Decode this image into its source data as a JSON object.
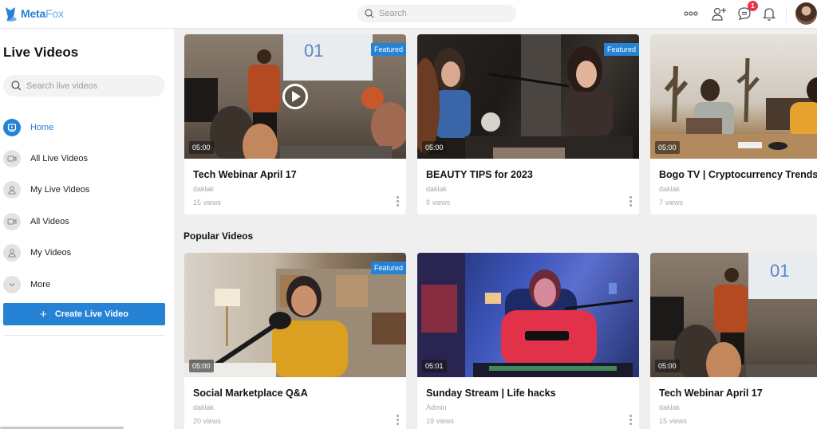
{
  "header": {
    "logo_text_bold": "Meta",
    "logo_text_light": "Fox",
    "search_placeholder": "Search",
    "notification_badge": "1",
    "icons": [
      "more-horizontal-icon",
      "add-friend-icon",
      "chat-icon",
      "bell-icon"
    ]
  },
  "sidebar": {
    "title": "Live Videos",
    "search_placeholder": "Search live videos",
    "items": [
      {
        "label": "Home",
        "icon": "home-video-icon",
        "active": true
      },
      {
        "label": "All Live Videos",
        "icon": "video-camera-icon",
        "active": false
      },
      {
        "label": "My Live Videos",
        "icon": "user-icon",
        "active": false
      },
      {
        "label": "All Videos",
        "icon": "video-camera-icon",
        "active": false
      },
      {
        "label": "My Videos",
        "icon": "user-icon",
        "active": false
      },
      {
        "label": "More",
        "icon": "chevron-down-icon",
        "active": false
      }
    ],
    "create_button": "Create Live Video"
  },
  "main": {
    "featured_row": [
      {
        "title": "Tech Webinar April 17",
        "author": "daklak",
        "views": "15 views",
        "duration": "05:00",
        "featured": "Featured",
        "has_play": true
      },
      {
        "title": "BEAUTY TIPS for 2023",
        "author": "daklak",
        "views": "9 views",
        "duration": "05:00",
        "featured": "Featured"
      },
      {
        "title": "Bogo TV | Cryptocurrency Trends",
        "author": "daklak",
        "views": "7 views",
        "duration": "05:00"
      }
    ],
    "popular_title": "Popular Videos",
    "popular_row": [
      {
        "title": "Social Marketplace Q&A",
        "author": "daklak",
        "views": "20 views",
        "duration": "05:00",
        "featured": "Featured"
      },
      {
        "title": "Sunday Stream | Life hacks",
        "author": "Admin",
        "views": "19 views",
        "duration": "05:01"
      },
      {
        "title": "Tech Webinar April 17",
        "author": "daklak",
        "views": "15 views",
        "duration": "05:00"
      }
    ]
  },
  "colors": {
    "accent": "#2682d5",
    "badge": "#e8344e",
    "background": "#efefef"
  }
}
